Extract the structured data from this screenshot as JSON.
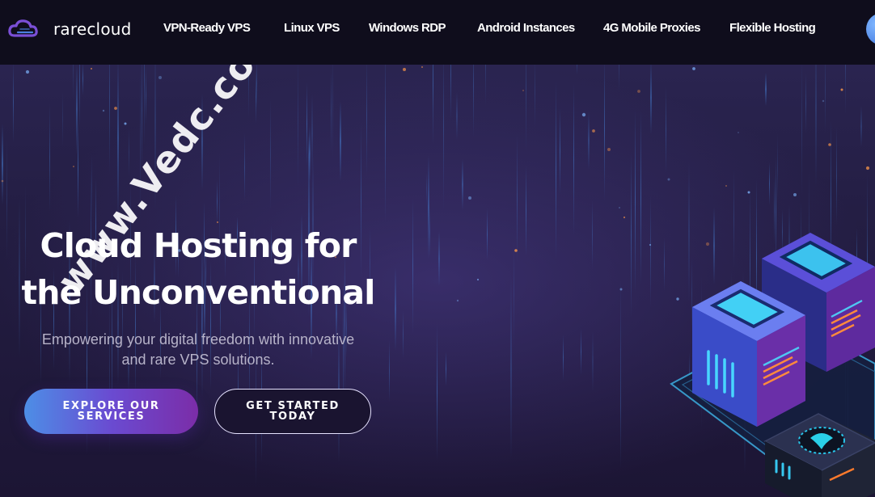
{
  "brand": {
    "name": "rarecloud",
    "logo_icon": "cloud-logo-icon",
    "colors": {
      "logo_cloud": "#7a4fd6",
      "logo_accent": "#4b7fe0"
    }
  },
  "nav": {
    "items": [
      {
        "label": "VPN-Ready VPS"
      },
      {
        "label": "Linux VPS"
      },
      {
        "label": "Windows RDP"
      },
      {
        "label": "Android Instances"
      },
      {
        "label": "4G Mobile Proxies"
      },
      {
        "label": "Flexible Hosting"
      }
    ],
    "account_icon": "user-avatar-icon"
  },
  "hero": {
    "title_line1": "Cloud Hosting for",
    "title_line2": "the Unconventional",
    "subtitle_line1": "Empowering your digital freedom with innovative",
    "subtitle_line2": "and rare VPS solutions.",
    "primary_cta_line1": "EXPLORE OUR",
    "primary_cta_line2": "SERVICES",
    "secondary_cta_line1": "GET STARTED",
    "secondary_cta_line2": "TODAY",
    "illustration": "isometric-servers-illustration",
    "colors": {
      "background": "#231d42",
      "header": "#0f0d1c",
      "subtitle": "#b7b3c9",
      "primary_gradient_start": "#4d8ee6",
      "primary_gradient_end": "#7b2da8"
    }
  },
  "watermark": {
    "text": "www.Vedc.com"
  }
}
